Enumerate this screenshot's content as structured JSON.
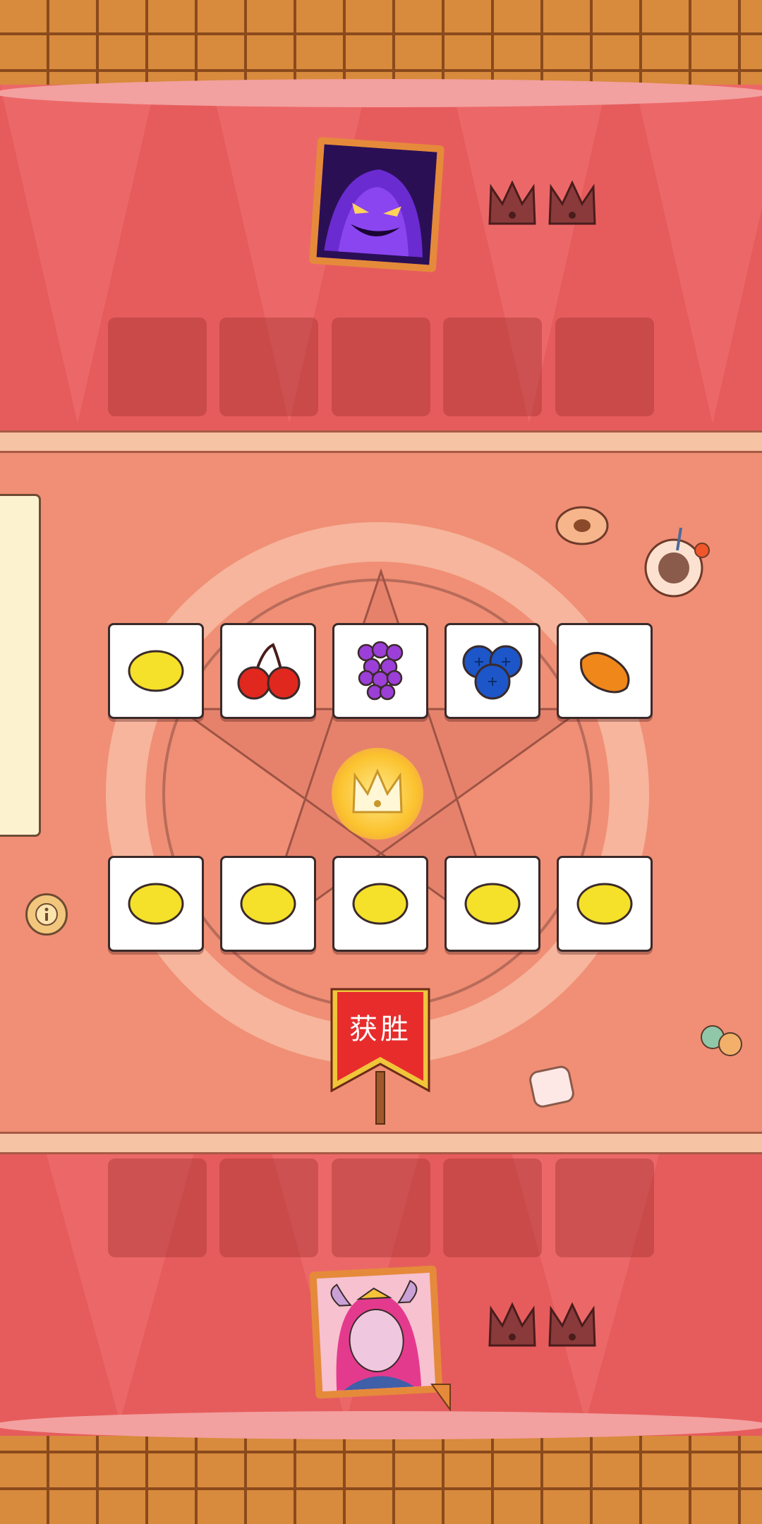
{
  "opponent": {
    "avatar_icon": "shadow-demon-portrait-icon",
    "crowns": [
      "crown-icon",
      "crown-icon"
    ],
    "slots": 5
  },
  "player": {
    "avatar_icon": "pink-hair-horned-girl-portrait-icon",
    "crowns": [
      "crown-icon",
      "crown-icon"
    ],
    "slots": 5
  },
  "board": {
    "top_row": [
      "lemon-icon",
      "cherry-icon",
      "grape-icon",
      "blueberry-icon",
      "orange-icon"
    ],
    "bottom_row": [
      "lemon-icon",
      "lemon-icon",
      "lemon-icon",
      "lemon-icon",
      "lemon-icon"
    ],
    "center_icon": "glowing-crown-icon"
  },
  "result_banner": {
    "label": "获胜"
  },
  "info_button": {
    "icon": "info-icon"
  },
  "colors": {
    "band_red": "#e65c5c",
    "table": "#f08f75",
    "lemon": "#f5e02a",
    "cherry": "#e0281f",
    "grape": "#9c3fd8",
    "blueberry": "#1c56c8",
    "orange": "#f0871a"
  }
}
